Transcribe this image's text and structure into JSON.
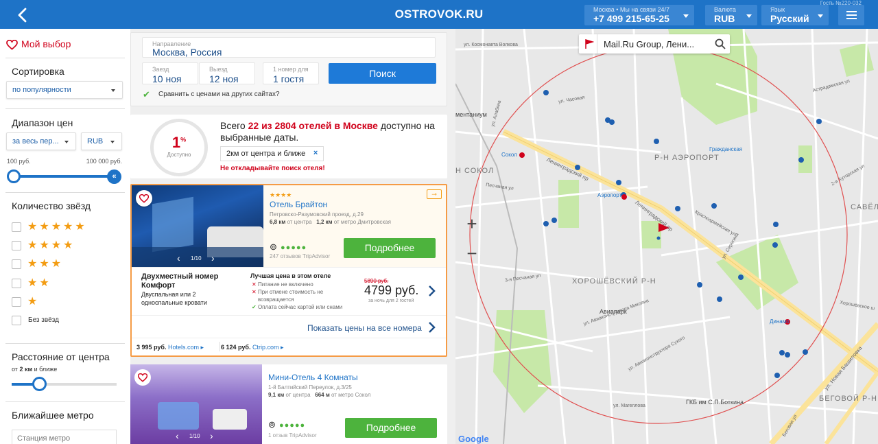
{
  "header": {
    "logo": "OSTROVOK.RU",
    "phone_label": "Москва  •  Мы на связи 24/7",
    "phone": "+7 499 215-65-25",
    "currency_label": "Валюта",
    "currency": "RUB",
    "language_label": "Язык",
    "language": "Русский",
    "guest_id": "Гость №220-032"
  },
  "sidebar": {
    "favorites": "Мой выбор",
    "sort_title": "Сортировка",
    "sort_value": "по популярности",
    "price_title": "Диапазон цен",
    "price_period": "за весь пер...",
    "price_currency": "RUB",
    "price_min": "100 руб.",
    "price_max": "100 000 руб.",
    "price_range_fraction": [
      0.0,
      1.0
    ],
    "stars_title": "Количество звёзд",
    "star_options": [
      5,
      4,
      3,
      2,
      1
    ],
    "no_stars": "Без звёзд",
    "distance_title": "Расстояние от центра",
    "distance_prefix": "от ",
    "distance_value": "2 км",
    "distance_suffix": " и ближе",
    "distance_fraction": 0.27,
    "metro_title": "Ближайшее метро",
    "metro_placeholder": "Станция метро"
  },
  "search": {
    "direction_label": "Направление",
    "direction_value": "Москва, Россия",
    "checkin_label": "Заезд",
    "checkin_value": "10 ноя",
    "checkout_label": "Выезд",
    "checkout_value": "12 ноя",
    "rooms_label": "1 номер для",
    "rooms_value": "1 гостя",
    "search_button": "Поиск",
    "compare_label": "Сравнить с ценами на других сайтах?"
  },
  "availability": {
    "percent": "1",
    "percent_sign": "%",
    "available_label": "Доступно",
    "text_prefix": "Всего ",
    "text_highlight": "22 из 2804 отелей в Москве",
    "text_suffix": " доступно на выбранные даты.",
    "filter_chip": "2км от центра и ближе",
    "warning": "Не откладывайте поиск отеля!"
  },
  "hotels": [
    {
      "stars": "★★★★",
      "name": "Отель Брайтон",
      "address": "Петровско-Разумовский проезд, д.29",
      "dist_center": "6,8 км",
      "dist_center_label": "от центра",
      "dist_metro": "1,2 км",
      "dist_metro_label": "от метро Дмитровская",
      "reviews": "247 отзывов TripAdvisor",
      "photo_counter": "1/10",
      "details_button": "Подробнее",
      "room_name": "Двухместный номер Комфорт",
      "room_beds": "Двуспальная или 2 односпальные кровати",
      "best_price_title": "Лучшая цена в этом отеле",
      "cond_1": "Питание не включено",
      "cond_2": "При отмене стоимость не возвращается",
      "cond_3": "Оплата сейчас картой или снами",
      "old_price": "5890 руб.",
      "price": "4799 руб.",
      "price_note": "за ночь для 2 гостей",
      "all_rooms_link": "Показать цены на все номера",
      "comp_1_price": "3 995 руб.",
      "comp_1_site": "Hotels.com",
      "comp_2_price": "6 124 руб.",
      "comp_2_site": "Ctrip.com"
    },
    {
      "name": "Мини-Отель 4 Комнаты",
      "address": "1-й Балтийский Переулок, д.3/25",
      "dist_center": "9,1 км",
      "dist_center_label": "от центра",
      "dist_metro": "664 м",
      "dist_metro_label": "от метро Сокол",
      "reviews": "1 отзыв TripAdvisor",
      "photo_counter": "1/10",
      "details_button": "Подробнее"
    }
  ],
  "map": {
    "search_value": "Mail.Ru Group, Лени...",
    "zoom_in": "+",
    "zoom_out": "−",
    "labels": {
      "district_aeroport": "Р-Н АЭРОПОРТ",
      "district_horosh": "ХОРОШЁВСКИЙ Р-Н",
      "district_begovoy": "БЕГОВОЙ Р-Н",
      "district_sokol": "Н СОКОЛ",
      "district_savel": "САВЁЛОВСКИ",
      "poi_aviapark": "Авиапарк",
      "poi_botkin": "ГКБ им С.П.Боткина",
      "street_len": "Ленинградский пр",
      "street_len2": "Ленинградский пр",
      "metro_aeroport": "Аэропорт",
      "metro_sokol": "Сокол",
      "metro_dinamo": "Динамо",
      "poi_grazh": "Гражданская",
      "poi_kom": "ментаниум",
      "street_chasov": "ул. Часовая",
      "street_kosmonavt": "ул. Космонавта Волкова",
      "street_pesch": "Песчаная ул",
      "street_3pesch": "3-я Песчаная ул",
      "street_sergeeva": "ул. Серегина",
      "street_khor": "Хорошёвское ш",
      "street_begov": "Беговая ул",
      "street_nbash": "ул. Новая Башиловка",
      "street_magelog": "ул. Магеллова",
      "street_kuus": "2-я Хуторская ул",
      "street_alabyan": "ул. Алабяна",
      "street_aviakon": "ул. Авиаконструктора Микояна",
      "street_aviakon2": "ул. Авиаконструктора Сухого",
      "street_astrad": "Астрадамская ул",
      "street_krasnoarm": "Красноармейская ул",
      "google": "Google"
    },
    "colors": {
      "base": "#e8e8e8",
      "park": "#c7e8a8",
      "main_road": "#fbe39a",
      "radius_circle": "#e05050",
      "pin": "#1e5fb0"
    }
  },
  "colors": {
    "brand_blue": "#1e73c7",
    "accent_red": "#d0021b",
    "button_green": "#4db33d",
    "star_orange": "#f39c12",
    "selected_border": "#f59b45"
  }
}
